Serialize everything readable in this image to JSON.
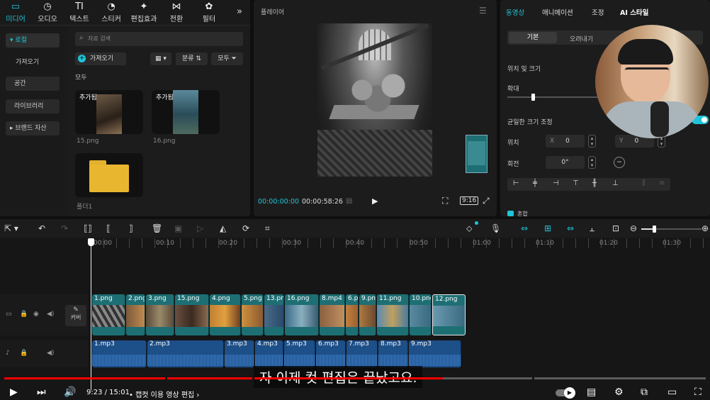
{
  "media_tabs": [
    {
      "label": "미디어",
      "icon": "▭"
    },
    {
      "label": "오디오",
      "icon": "◷"
    },
    {
      "label": "텍스트",
      "icon": "TI"
    },
    {
      "label": "스티커",
      "icon": "◔"
    },
    {
      "label": "편집효과",
      "icon": "✦"
    },
    {
      "label": "전환",
      "icon": "⋈"
    },
    {
      "label": "필터",
      "icon": "✿"
    }
  ],
  "more_icon": "»",
  "sidebar": [
    {
      "label": "▾ 로컬"
    },
    {
      "label": "가져오기"
    },
    {
      "label": "공간"
    },
    {
      "label": "라이브러리"
    },
    {
      "label": "▸ 브랜드 자산"
    }
  ],
  "search": {
    "placeholder": "자료 검색"
  },
  "import_label": "가져오기",
  "sort_label": "분류",
  "filter_label": "모두",
  "all_label": "모두",
  "media": [
    {
      "tag": "추가됨",
      "name": "15.png"
    },
    {
      "tag": "추가됨",
      "name": "16.png"
    },
    {
      "tag": "",
      "name": "폴더1"
    }
  ],
  "player": {
    "title": "플레이어",
    "current": "00:00:00:00",
    "total": "00:00:58:26",
    "ratio": "9:16"
  },
  "right_tabs": [
    "동영상",
    "애니메이션",
    "조정",
    "AI 스타일"
  ],
  "sub_tabs": [
    "기본",
    "오려내기"
  ],
  "props": {
    "pos_size": "위치 및 크기",
    "scale": "확대",
    "uniform": "균일한 크기 조정",
    "position": "위치",
    "x_label": "X",
    "x_val": "0",
    "y_label": "Y",
    "y_val": "0",
    "rotate": "회전",
    "rotate_val": "0°",
    "blend": "혼합"
  },
  "ruler": [
    "00:00",
    "00:10",
    "00:20",
    "00:30",
    "00:40",
    "00:50",
    "01:00",
    "01:10",
    "01:20",
    "01:30"
  ],
  "cover_label": "커버",
  "video_clips": [
    "1.png",
    "2.png",
    "3.png",
    "15.png",
    "4.png",
    "5.png",
    "13.pn",
    "16.png",
    "8.mp4",
    "6.p",
    "9.pn",
    "11.png",
    "10.png",
    "12.png"
  ],
  "audio_clips": [
    "1.mp3",
    "2.mp3",
    "3.mp3",
    "4.mp3",
    "5.mp3",
    "6.mp3",
    "7.mp3",
    "8.mp3",
    "9.mp3"
  ],
  "subtitle": "자 이제 컷 편집은 끝났고요.",
  "yt": {
    "time": "9:23 / 15:01",
    "chapter": "• 캡컷 이용 영상 편집 ›",
    "progress": 0.625
  }
}
